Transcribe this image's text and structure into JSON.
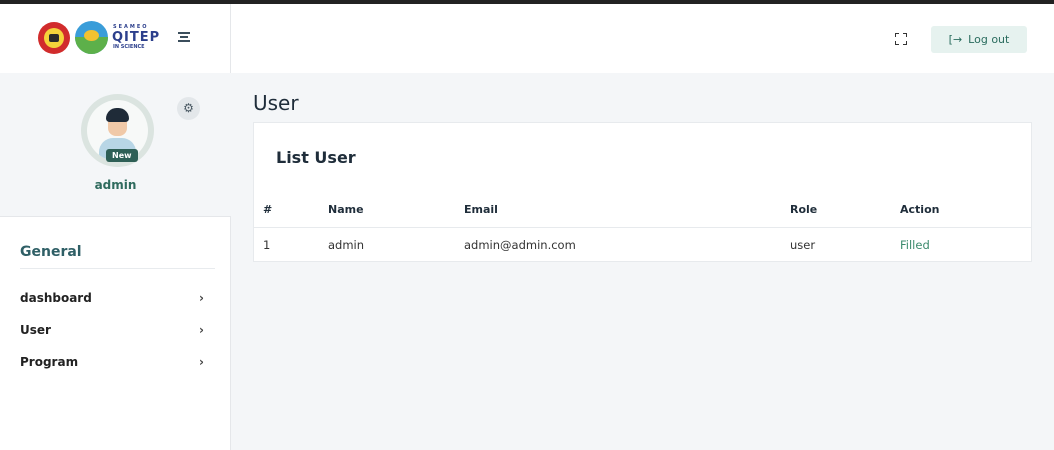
{
  "brand": {
    "logo_top_text": "SEAMEO",
    "logo_main_text": "QITEP",
    "logo_sub_text": "IN SCIENCE"
  },
  "sidebar": {
    "profile": {
      "badge": "New",
      "name": "admin"
    },
    "section_title": "General",
    "items": [
      {
        "label": "dashboard",
        "chevron": "›"
      },
      {
        "label": "User",
        "chevron": "›"
      },
      {
        "label": "Program",
        "chevron": "›"
      }
    ]
  },
  "topbar": {
    "logout_icon": "[→",
    "logout_label": "Log out"
  },
  "main": {
    "page_title": "User",
    "card_title": "List User",
    "table": {
      "headers": [
        "#",
        "Name",
        "Email",
        "Role",
        "Action"
      ],
      "rows": [
        [
          "1",
          "admin",
          "admin@admin.com",
          "user",
          "Filled"
        ]
      ]
    }
  },
  "icons": [
    "menu-icon",
    "gear-icon",
    "fullscreen-icon",
    "logout-icon",
    "chevron-right-icon"
  ],
  "colors": {
    "accent": "#2f6b5e",
    "badge": "#2e5f56",
    "logout_bg": "#e6f2ef",
    "action": "#3c8a6d"
  }
}
